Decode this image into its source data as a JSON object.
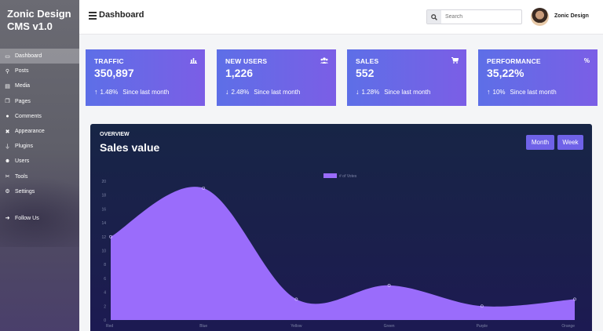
{
  "sidebar": {
    "brand": "Zonic Design CMS v1.0",
    "items": [
      {
        "label": "Dashboard",
        "icon": "monitor-icon",
        "active": true
      },
      {
        "label": "Posts",
        "icon": "pin-icon"
      },
      {
        "label": "Media",
        "icon": "images-icon"
      },
      {
        "label": "Pages",
        "icon": "copy-icon"
      },
      {
        "label": "Comments",
        "icon": "comments-icon"
      },
      {
        "label": "Appearance",
        "icon": "paint-icon"
      },
      {
        "label": "Plugins",
        "icon": "plug-icon"
      },
      {
        "label": "Users",
        "icon": "users-icon"
      },
      {
        "label": "Tools",
        "icon": "tools-icon"
      },
      {
        "label": "Settings",
        "icon": "cogs-icon"
      }
    ],
    "follow_label": "Follow Us"
  },
  "header": {
    "title": "Dashboard",
    "search_placeholder": "Search",
    "username": "Zonic Design"
  },
  "cards": [
    {
      "title": "TRAFFIC",
      "value": "350,897",
      "change": "1.48%",
      "direction": "up",
      "since": "Since last month",
      "icon": "chart-bar-icon"
    },
    {
      "title": "NEW USERS",
      "value": "1,226",
      "change": "2.48%",
      "direction": "down",
      "since": "Since last month",
      "icon": "users-icon"
    },
    {
      "title": "SALES",
      "value": "552",
      "change": "1.28%",
      "direction": "down",
      "since": "Since last month",
      "icon": "cart-icon"
    },
    {
      "title": "PERFORMANCE",
      "value": "35,22%",
      "change": "10%",
      "direction": "up",
      "since": "Since last month",
      "icon": "percent-icon",
      "icon_glyph": "%"
    }
  ],
  "panel": {
    "overview": "OVERVIEW",
    "title": "Sales value",
    "month_label": "Month",
    "week_label": "Week"
  },
  "colors": {
    "accent": "#7b5ee6",
    "area": "#9a6cfb",
    "panel_bg": "#1b1f4c"
  },
  "chart_data": {
    "type": "area",
    "categories": [
      "Red",
      "Blue",
      "Yellow",
      "Green",
      "Purple",
      "Orange"
    ],
    "series": [
      {
        "name": "# of Votes",
        "values": [
          12,
          19,
          3,
          5,
          2,
          3
        ]
      }
    ],
    "ylim": [
      0,
      20
    ],
    "yticks": [
      0,
      2,
      4,
      6,
      8,
      10,
      12,
      14,
      16,
      18,
      20
    ],
    "legend": "top-center",
    "grid": false
  }
}
